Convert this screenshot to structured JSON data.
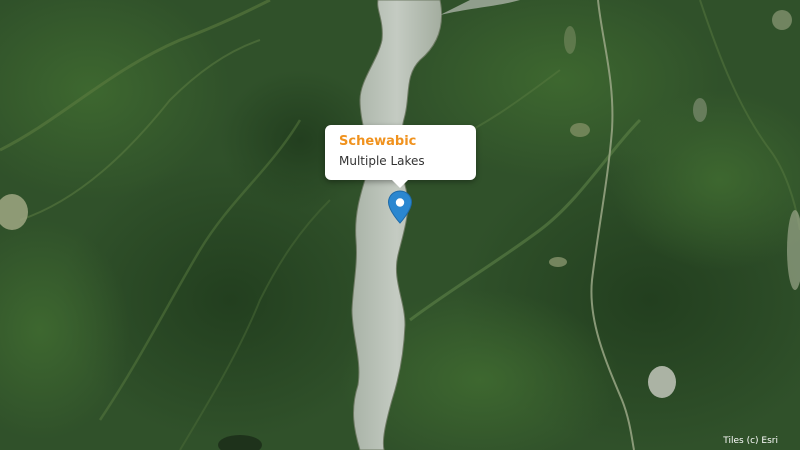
{
  "map": {
    "basemap": "satellite imagery",
    "marker_icon": "map-pin-icon",
    "marker_color": "#2a87d0",
    "popup": {
      "title": "Schewabic",
      "subtitle": "Multiple Lakes",
      "title_color": "#f0921e"
    },
    "attribution": "Tiles (c) Esri"
  }
}
